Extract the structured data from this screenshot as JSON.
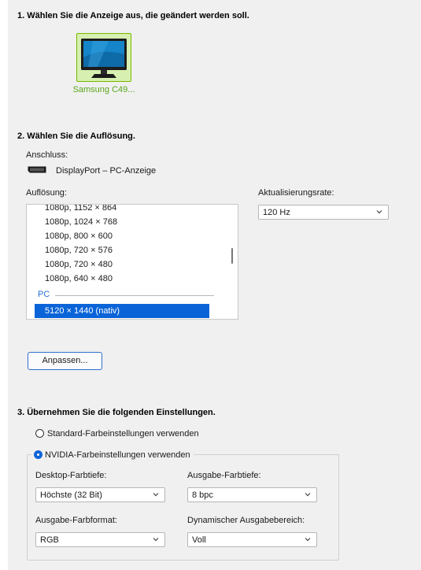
{
  "section1": {
    "heading": "1. Wählen Sie die Anzeige aus, die geändert werden soll.",
    "display_name": "Samsung C49..."
  },
  "section2": {
    "heading": "2. Wählen Sie die Auflösung.",
    "connection_label": "Anschluss:",
    "connection_value": "DisplayPort – PC-Anzeige",
    "resolution_label": "Auflösung:",
    "refresh_label": "Aktualisierungsrate:",
    "refresh_value": "120 Hz",
    "resolutions": [
      "1080p, 1152 × 864",
      "1080p, 1024 × 768",
      "1080p, 800 × 600",
      "1080p, 720 × 576",
      "1080p, 720 × 480",
      "1080p, 640 × 480"
    ],
    "group_pc": "PC",
    "selected_resolution": "5120 × 1440 (nativ)",
    "customize_button": "Anpassen..."
  },
  "section3": {
    "heading": "3. Übernehmen Sie die folgenden Einstellungen.",
    "radio_default": "Standard-Farbeinstellungen verwenden",
    "radio_nvidia": "NVIDIA-Farbeinstellungen verwenden",
    "radio_nvidia_selected": true,
    "desktop_depth_label": "Desktop-Farbtiefe:",
    "desktop_depth_value": "Höchste (32 Bit)",
    "output_depth_label": "Ausgabe-Farbtiefe:",
    "output_depth_value": "8 bpc",
    "output_format_label": "Ausgabe-Farbformat:",
    "output_format_value": "RGB",
    "dynamic_range_label": "Dynamischer Ausgabebereich:",
    "dynamic_range_value": "Voll"
  },
  "colors": {
    "accent_green": "#76b900",
    "selection_blue": "#0a64d8",
    "background": "#f0f0f0"
  },
  "icons": [
    "monitor-icon",
    "displayport-icon",
    "chevron-down-icon"
  ]
}
